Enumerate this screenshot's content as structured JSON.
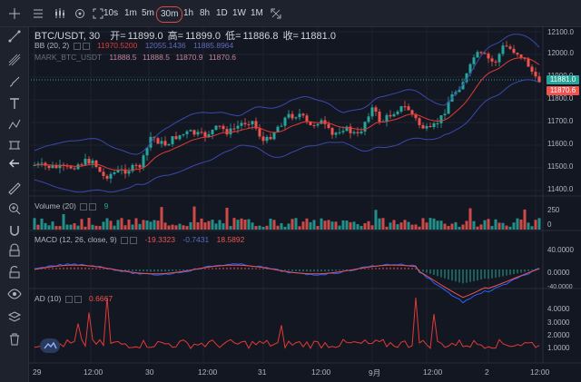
{
  "toolbar": {
    "intervals": [
      "10s",
      "1m",
      "5m",
      "30m",
      "1h",
      "8h",
      "1D",
      "1W",
      "1M"
    ],
    "active_interval": "30m"
  },
  "symbol": {
    "name": "BTC/USDT, 30",
    "open_label": "开=",
    "open": "11899.0",
    "high_label": "高=",
    "high": "11899.0",
    "low_label": "低=",
    "low": "11886.8",
    "close_label": "收=",
    "close": "11881.0"
  },
  "indicators": {
    "bb": {
      "label": "BB (20, 2)",
      "basis": "11970.5200",
      "upper": "12055.1436",
      "lower": "11885.8964"
    },
    "mark": {
      "label": "MARK_BTC_USDT",
      "v1": "11888.5",
      "v2": "11888.5",
      "v3": "11870.9",
      "v4": "11870.6"
    },
    "volume": {
      "label": "Volume (20)",
      "value": "9"
    },
    "macd": {
      "label": "MACD (12, 26, close, 9)",
      "hist": "-19.3323",
      "macd": "-0.7431",
      "signal": "18.5892"
    },
    "ad": {
      "label": "AD (10)",
      "value": "0.6667"
    }
  },
  "price_axis": [
    "12100.0",
    "12000.0",
    "11900.0",
    "11800.0",
    "11700.0",
    "11600.0",
    "11500.0",
    "11400.0"
  ],
  "price_tags": {
    "last": "11881.0",
    "mark": "11870.6"
  },
  "volume_axis": [
    "250",
    "0"
  ],
  "macd_axis": [
    "40.0000",
    "0.0000",
    "-40.0000"
  ],
  "ad_axis": [
    "4.0000",
    "3.0000",
    "2.0000",
    "1.0000"
  ],
  "time_axis": [
    "29",
    "12:00",
    "30",
    "12:00",
    "31",
    "12:00",
    "9月",
    "12:00",
    "2",
    "12:00"
  ],
  "colors": {
    "up": "#26a69a",
    "down": "#ef5350",
    "bb_band": "#3949ab",
    "bb_basis": "#e53935",
    "bg": "#131722"
  }
}
